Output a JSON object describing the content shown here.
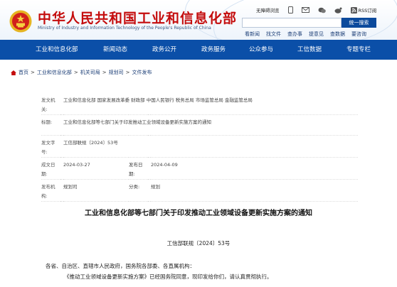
{
  "header": {
    "title": "中华人民共和国工业和信息化部",
    "subtitle": "Ministry of Industry and Information Technology of the People's Republic of China",
    "util_links": [
      "无障碍浏览",
      "",
      "",
      "",
      "RSS订阅"
    ],
    "search_placeholder": "",
    "search_button": "统一搜索",
    "quick_links": [
      "看新闻",
      "找文件",
      "查办事",
      "提意见",
      "查数据",
      "要咨询"
    ]
  },
  "nav": {
    "items": [
      "工业和信息化部",
      "新闻动态",
      "政务公开",
      "政务服务",
      "公众参与",
      "工信数据",
      "专题专栏"
    ]
  },
  "breadcrumb": [
    "首页",
    "工业和信息化部",
    "机关司局",
    "规划司",
    "文件发布"
  ],
  "meta": {
    "issuer_label": "发文机关:",
    "issuer": "工业和信息化部 国家发展改革委 财政部 中国人民银行 税务总局 市场监管总局 金融监管总局",
    "title_label": "标题:",
    "title": "工业和信息化部等七部门关于印发推动工业领域设备更新实施方案的通知",
    "number_label": "发文字号:",
    "number": "工信部联规〔2024〕53号",
    "date_label": "成文日期:",
    "date": "2024-03-27",
    "pub_label": "发布日期:",
    "pub": "2024-04-09",
    "org_label": "发布机构:",
    "org": "规划司",
    "cat_label": "分类:",
    "cat": "规划"
  },
  "document": {
    "title": "工业和信息化部等七部门关于印发推动工业领域设备更新实施方案的通知",
    "number": "工信部联规〔2024〕53号",
    "addressee": "各省、自治区、直辖市人民政府，国务院各部委、各直属机构：",
    "paragraph1": "《推动工业领域设备更新实施方案》已经国务院同意，现印发给你们，请认真贯彻执行。"
  },
  "colors": {
    "brand_red": "#c40d0d",
    "nav_blue": "#0b4fa8",
    "search_blue": "#0b4a9c"
  },
  "icons": [
    "national-emblem-icon",
    "accessibility-icon",
    "mobile-icon",
    "mail-icon",
    "wechat-icon",
    "weibo-icon",
    "rss-icon",
    "home-icon"
  ]
}
